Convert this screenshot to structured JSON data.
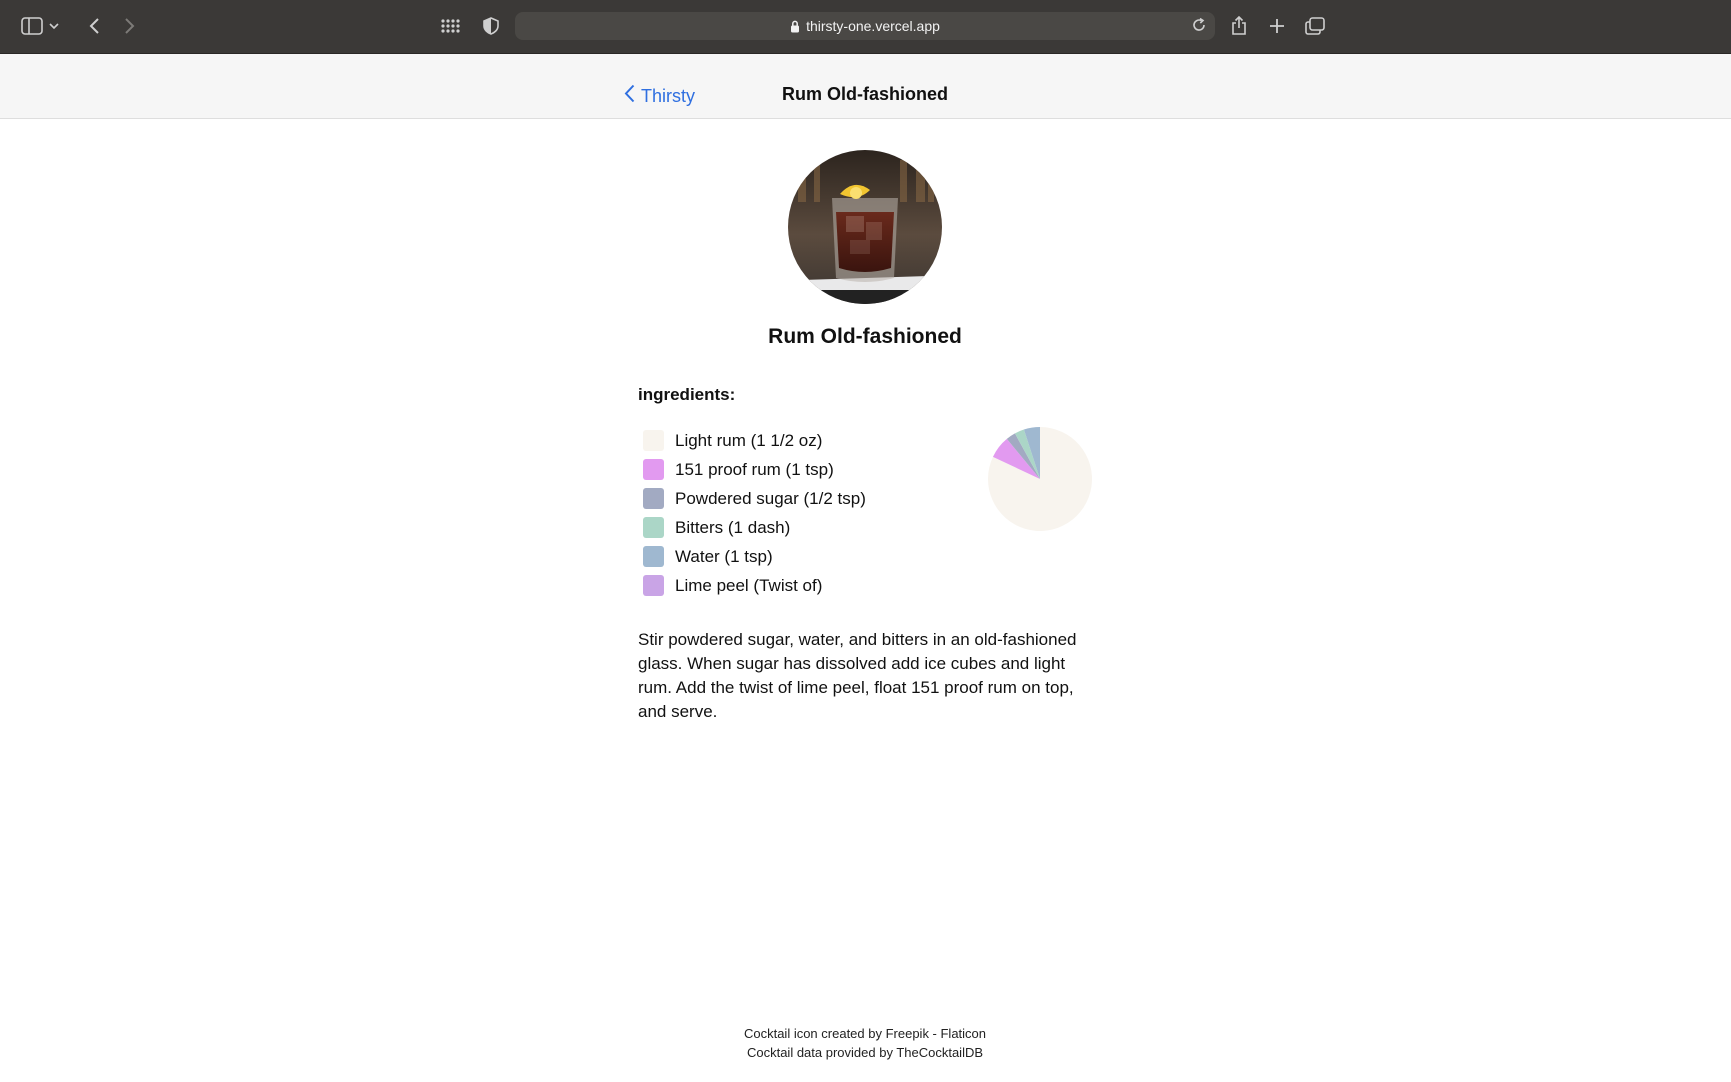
{
  "browser": {
    "url": "thirsty-one.vercel.app",
    "icons": [
      "sidebar-icon",
      "chevron-down-icon",
      "back-arrow-icon",
      "forward-arrow-icon",
      "grid-icon",
      "shield-icon",
      "lock-icon",
      "reload-icon",
      "share-icon",
      "plus-icon",
      "tabs-icon"
    ]
  },
  "nav": {
    "back_label": "Thirsty",
    "title": "Rum Old-fashioned"
  },
  "drink": {
    "name": "Rum Old-fashioned",
    "ingredients_heading": "ingredients:",
    "ingredients": [
      {
        "label": "Light rum (1 1/2 oz)",
        "color": "#f8f4ee"
      },
      {
        "label": "151 proof rum (1 tsp)",
        "color": "#e29af0"
      },
      {
        "label": "Powdered sugar (1/2 tsp)",
        "color": "#a2aac2"
      },
      {
        "label": "Bitters (1 dash)",
        "color": "#abd6c7"
      },
      {
        "label": "Water (1 tsp)",
        "color": "#9fb8d0"
      },
      {
        "label": "Lime peel (Twist of)",
        "color": "#c9a4e6"
      }
    ],
    "instructions": "Stir powdered sugar, water, and bitters in an old-fashioned glass. When sugar has dissolved add ice cubes and light rum. Add the twist of lime peel, float 151 proof rum on top, and serve."
  },
  "chart_data": {
    "type": "pie",
    "slices": [
      {
        "label": "Light rum (1 1/2 oz)",
        "value": 0.82,
        "color": "#f8f4ee"
      },
      {
        "label": "151 proof rum (1 tsp)",
        "value": 0.07,
        "color": "#e29af0"
      },
      {
        "label": "Powdered sugar (1/2 tsp)",
        "value": 0.03,
        "color": "#a2aac2"
      },
      {
        "label": "Bitters (1 dash)",
        "value": 0.03,
        "color": "#abd6c7"
      },
      {
        "label": "Water (1 tsp)",
        "value": 0.05,
        "color": "#9fb8d0"
      }
    ]
  },
  "footer": {
    "line1": "Cocktail icon created by Freepik - Flaticon",
    "line2": "Cocktail data provided by TheCocktailDB"
  }
}
